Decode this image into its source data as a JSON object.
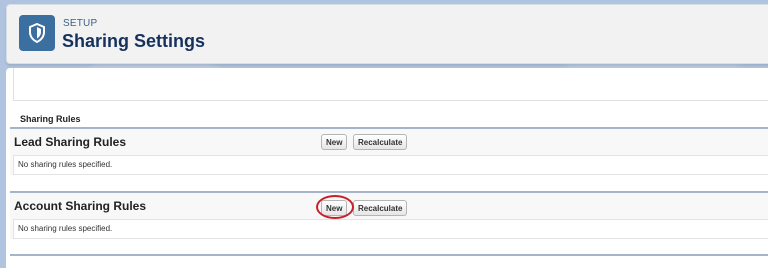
{
  "header": {
    "eyebrow": "SETUP",
    "title": "Sharing Settings",
    "icon": "shield-icon",
    "icon_color": "#3a6fa0"
  },
  "section": {
    "label": "Sharing Rules"
  },
  "rules": [
    {
      "title": "Lead Sharing Rules",
      "new_label": "New",
      "recalculate_label": "Recalculate",
      "empty_text": "No sharing rules specified."
    },
    {
      "title": "Account Sharing Rules",
      "new_label": "New",
      "recalculate_label": "Recalculate",
      "empty_text": "No sharing rules specified."
    }
  ],
  "annotation": {
    "highlight_color": "#c8202b"
  }
}
